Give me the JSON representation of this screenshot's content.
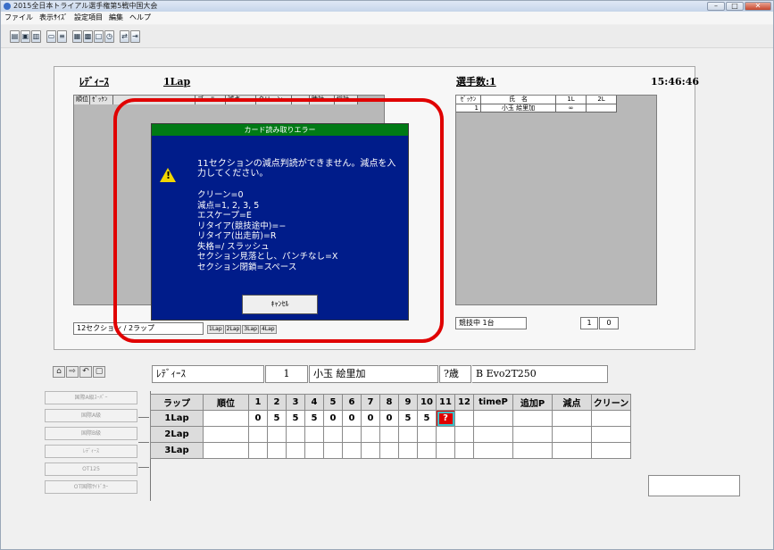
{
  "title": "2015全日本トライアル選手権第5戦中国大会",
  "menu": [
    "ファイル",
    "表示ｻｲｽﾞ",
    "設定項目",
    "編集",
    "ヘルプ"
  ],
  "upper": {
    "class": "ﾚﾃﾞｨｰｽ",
    "lap": "1Lap",
    "riders": "選手数:1",
    "clock": "15:46:46",
    "left_headers": [
      "順位",
      "ｾﾞｯｹﾝ",
      "",
      "ゴール",
      "減点",
      "クリーン",
      "",
      "時計",
      "総計"
    ],
    "right_headers": [
      "ｾﾞｯｹﾝ",
      "氏　名",
      "1L",
      "2L"
    ],
    "right_row": [
      "1",
      "小玉 絵里加",
      "∞",
      ""
    ],
    "section_box": "12セクション / 2ラップ",
    "running": "競技中 1台",
    "count": "1",
    "count2": "0",
    "mini": [
      "1Lap",
      "2Lap",
      "3Lap",
      "4Lap"
    ]
  },
  "dialog": {
    "title": "カード読み取りエラー",
    "message": "11セクションの減点判読ができません。減点を入力してください。",
    "lines": [
      "クリーン=0",
      "減点=1, 2, 3, 5",
      "エスケープ=E",
      "リタイア(競技途中)=−",
      "リタイア(出走前)=R",
      "失格=/ スラッシュ",
      "セクション見落とし、パンチなし=X",
      "セクション閉鎖=スペース"
    ],
    "cancel": "ｷｬﾝｾﾙ"
  },
  "rider": {
    "class": "ﾚﾃﾞｨｰｽ",
    "number": "1",
    "name": "小玉 絵里加",
    "age": "?歳",
    "bike": "B Evo2T250"
  },
  "side_buttons": [
    "国際A級ｽｰﾊﾟｰ",
    "国際A級",
    "国際B級",
    "ﾚﾃﾞｨｰｽ",
    "OT125",
    "OT国際ｻｲﾄﾞｶｰ"
  ],
  "grid": {
    "headers": [
      "ラップ",
      "順位",
      "1",
      "2",
      "3",
      "4",
      "5",
      "6",
      "7",
      "8",
      "9",
      "10",
      "11",
      "12",
      "timeP",
      "追加P",
      "減点",
      "クリーン"
    ],
    "rows": [
      {
        "lap": "1Lap",
        "scores": [
          "0",
          "5",
          "5",
          "5",
          "0",
          "0",
          "0",
          "0",
          "5",
          "5",
          "?",
          ""
        ]
      },
      {
        "lap": "2Lap",
        "scores": [
          "",
          "",
          "",
          "",
          "",
          "",
          "",
          "",
          "",
          "",
          "",
          ""
        ]
      },
      {
        "lap": "3Lap",
        "scores": [
          "",
          "",
          "",
          "",
          "",
          "",
          "",
          "",
          "",
          "",
          "",
          ""
        ]
      }
    ]
  }
}
